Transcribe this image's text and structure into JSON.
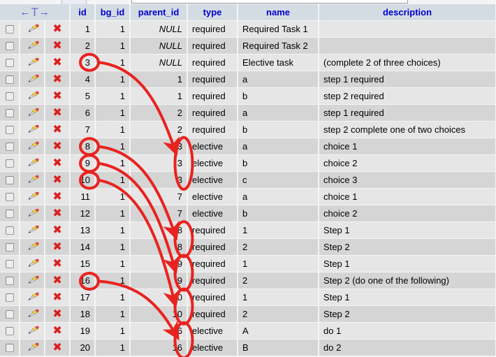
{
  "table": {
    "columns": [
      {
        "key": "check",
        "label": "",
        "icon": "checkbox-column"
      },
      {
        "key": "edit",
        "label": "",
        "icon": "edit-column"
      },
      {
        "key": "del",
        "label": "",
        "icon": "delete-column"
      },
      {
        "key": "id",
        "label": "id"
      },
      {
        "key": "bg_id",
        "label": "bg_id"
      },
      {
        "key": "parent_id",
        "label": "parent_id"
      },
      {
        "key": "type",
        "label": "type"
      },
      {
        "key": "name",
        "label": "name"
      },
      {
        "key": "description",
        "label": "description"
      }
    ],
    "sort_control": {
      "left_arrow": "←",
      "tee": "T",
      "right_arrow": "→"
    },
    "row_icons": {
      "edit": "pencil-icon",
      "delete": "red-x-icon",
      "select": "row-checkbox"
    },
    "null_label": "NULL",
    "rows": [
      {
        "id": "1",
        "bg_id": "1",
        "parent_id": "NULL",
        "type": "required",
        "name": "Required Task 1",
        "description": ""
      },
      {
        "id": "2",
        "bg_id": "1",
        "parent_id": "NULL",
        "type": "required",
        "name": "Required Task 2",
        "description": ""
      },
      {
        "id": "3",
        "bg_id": "1",
        "parent_id": "NULL",
        "type": "required",
        "name": "Elective task",
        "description": "(complete 2 of three choices)"
      },
      {
        "id": "4",
        "bg_id": "1",
        "parent_id": "1",
        "type": "required",
        "name": "a",
        "description": "step 1 required"
      },
      {
        "id": "5",
        "bg_id": "1",
        "parent_id": "1",
        "type": "required",
        "name": "b",
        "description": "step 2 required"
      },
      {
        "id": "6",
        "bg_id": "1",
        "parent_id": "2",
        "type": "required",
        "name": "a",
        "description": "step 1 required"
      },
      {
        "id": "7",
        "bg_id": "1",
        "parent_id": "2",
        "type": "required",
        "name": "b",
        "description": "step 2 complete one of two choices"
      },
      {
        "id": "8",
        "bg_id": "1",
        "parent_id": "3",
        "type": "elective",
        "name": "a",
        "description": "choice 1"
      },
      {
        "id": "9",
        "bg_id": "1",
        "parent_id": "3",
        "type": "elective",
        "name": "b",
        "description": "choice 2"
      },
      {
        "id": "10",
        "bg_id": "1",
        "parent_id": "3",
        "type": "elective",
        "name": "c",
        "description": "choice 3"
      },
      {
        "id": "11",
        "bg_id": "1",
        "parent_id": "7",
        "type": "elective",
        "name": "a",
        "description": "choice 1"
      },
      {
        "id": "12",
        "bg_id": "1",
        "parent_id": "7",
        "type": "elective",
        "name": "b",
        "description": "choice 2"
      },
      {
        "id": "13",
        "bg_id": "1",
        "parent_id": "8",
        "type": "required",
        "name": "1",
        "description": "Step 1"
      },
      {
        "id": "14",
        "bg_id": "1",
        "parent_id": "8",
        "type": "required",
        "name": "2",
        "description": "Step 2"
      },
      {
        "id": "15",
        "bg_id": "1",
        "parent_id": "9",
        "type": "required",
        "name": "1",
        "description": "Step 1"
      },
      {
        "id": "16",
        "bg_id": "1",
        "parent_id": "9",
        "type": "required",
        "name": "2",
        "description": "Step 2 (do one of the following)"
      },
      {
        "id": "17",
        "bg_id": "1",
        "parent_id": "10",
        "type": "required",
        "name": "1",
        "description": "Step 1"
      },
      {
        "id": "18",
        "bg_id": "1",
        "parent_id": "10",
        "type": "required",
        "name": "2",
        "description": "Step 2"
      },
      {
        "id": "19",
        "bg_id": "1",
        "parent_id": "16",
        "type": "elective",
        "name": "A",
        "description": "do 1"
      },
      {
        "id": "20",
        "bg_id": "1",
        "parent_id": "16",
        "type": "elective",
        "name": "B",
        "description": "do 2"
      }
    ]
  },
  "annotations": {
    "color": "#e8231f",
    "stroke_width": 4,
    "circled_ids": [
      "3",
      "8",
      "9",
      "10",
      "16"
    ],
    "circled_parent_groups": [
      {
        "parent_id": "3",
        "row_ids": [
          "8",
          "9",
          "10"
        ]
      },
      {
        "parent_id": "8",
        "row_ids": [
          "13",
          "14"
        ]
      },
      {
        "parent_id": "9",
        "row_ids": [
          "15",
          "16"
        ]
      },
      {
        "parent_id": "10",
        "row_ids": [
          "17",
          "18"
        ]
      },
      {
        "parent_id": "16",
        "row_ids": [
          "19",
          "20"
        ]
      }
    ],
    "links": [
      {
        "from_id": "3",
        "to_parent_group": "3"
      },
      {
        "from_id": "8",
        "to_parent_group": "8"
      },
      {
        "from_id": "9",
        "to_parent_group": "9"
      },
      {
        "from_id": "10",
        "to_parent_group": "10"
      },
      {
        "from_id": "16",
        "to_parent_group": "16"
      }
    ]
  },
  "colors": {
    "header_bg": "#d3dce3",
    "header_text": "#0000ce",
    "row_odd": "#e6e6e6",
    "row_even": "#d5d5d5",
    "page_bg": "#f4f4f4",
    "annotation_red": "#e8231f",
    "delete_icon": "#d81f1f"
  }
}
